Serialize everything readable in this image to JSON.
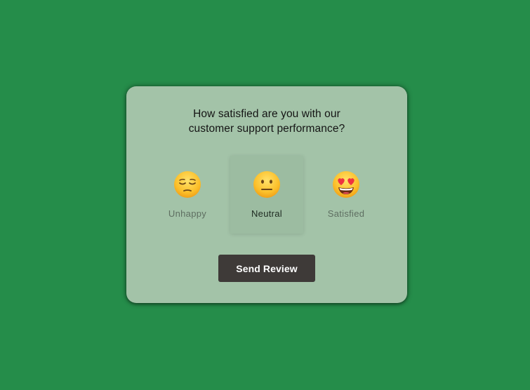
{
  "card": {
    "question_line1": "How satisfied are you with our",
    "question_line2": "customer support performance?"
  },
  "options": [
    {
      "label": "Unhappy",
      "icon": "relieved-face-icon",
      "selected": false
    },
    {
      "label": "Neutral",
      "icon": "neutral-face-icon",
      "selected": true
    },
    {
      "label": "Satisfied",
      "icon": "heart-eyes-face-icon",
      "selected": false
    }
  ],
  "button": {
    "label": "Send Review"
  },
  "colors": {
    "background": "#258d4a",
    "card": "#a3c3a8",
    "button": "#3e3a38"
  }
}
